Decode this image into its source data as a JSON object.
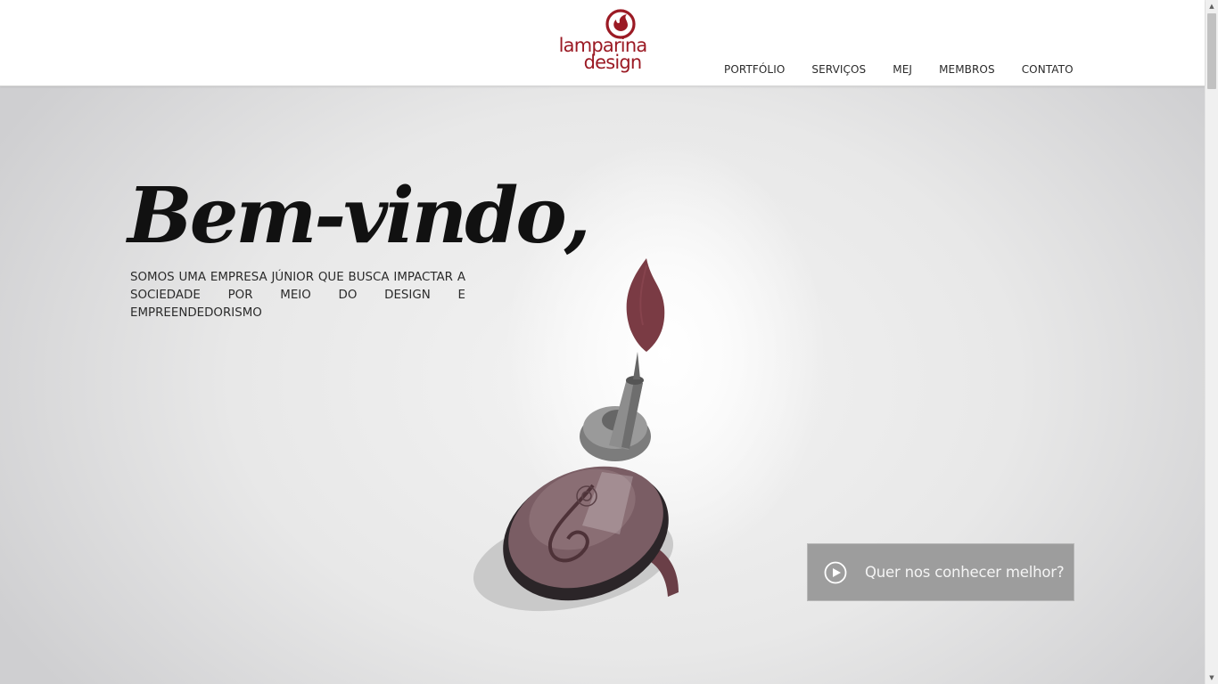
{
  "header": {
    "logo": {
      "line1": "lamparina",
      "line2": "design",
      "icon": "flame-circle-icon"
    },
    "nav": [
      {
        "label": "PORTFÓLIO"
      },
      {
        "label": "SERVIÇOS"
      },
      {
        "label": "MEJ"
      },
      {
        "label": "MEMBROS"
      },
      {
        "label": "CONTATO"
      }
    ]
  },
  "hero": {
    "headline": "Bem-vindo,",
    "subtitle_line1": "SOMOS UMA EMPRESA JÚNIOR QUE BUSCA IMPACTAR A",
    "subtitle_line2": "SOCIEDADE POR MEIO DO DESIGN E EMPREENDEDORISMO",
    "illustration": "oil-lamp-illustration",
    "cta": {
      "label": "Quer nos conhecer melhor?",
      "icon": "play-circle-icon"
    }
  },
  "colors": {
    "brand": "#9b1a24",
    "lamp_body": "#76585f",
    "flame": "#7a3b44",
    "cta_bg": "#9d9d9d"
  }
}
